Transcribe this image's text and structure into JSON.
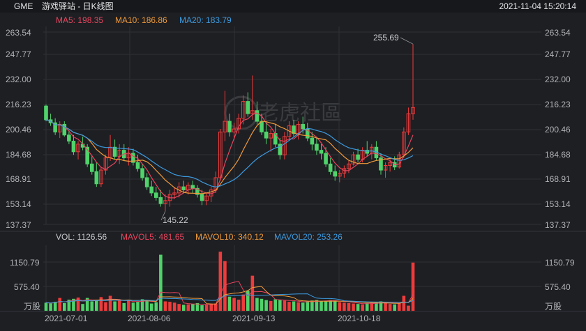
{
  "header": {
    "symbol": "GME",
    "name": "游戏驿站 - 日K线图",
    "datetime": "2021-11-04 15:20:14"
  },
  "ma_legend": [
    {
      "label": "MA5: 198.35",
      "color": "#e8455e"
    },
    {
      "label": "MA10: 186.86",
      "color": "#f09a3a"
    },
    {
      "label": "MA20: 183.79",
      "color": "#3c9be0"
    }
  ],
  "vol_legend": [
    {
      "label": "VOL: 1126.56",
      "color": "#c8c9cc"
    },
    {
      "label": "MAVOL5: 481.65",
      "color": "#e8455e"
    },
    {
      "label": "MAVOL10: 340.12",
      "color": "#f09a3a"
    },
    {
      "label": "MAVOL20: 253.26",
      "color": "#3c9be0"
    }
  ],
  "watermark": "老虎社區",
  "colors": {
    "up": "#ef3b3b",
    "down": "#4fd36a",
    "grid": "#2e3036",
    "axis_text": "#b0b2b6",
    "background": "#1e1f23"
  },
  "chart_data": [
    {
      "type": "candlestick",
      "title": "游戏驿站 - 日K线图",
      "y_ticks": [
        "263.54",
        "247.77",
        "232.00",
        "216.23",
        "200.46",
        "184.68",
        "168.91",
        "153.14",
        "137.37"
      ],
      "ylim": [
        137.37,
        263.54
      ],
      "annotations": {
        "high": "255.69",
        "low": "145.22"
      },
      "ohlc": [
        [
          215,
          216,
          205,
          206
        ],
        [
          206,
          210,
          202,
          204
        ],
        [
          204,
          207,
          196,
          198
        ],
        [
          198,
          205,
          194,
          203
        ],
        [
          203,
          205,
          195,
          196
        ],
        [
          196,
          199,
          190,
          192
        ],
        [
          192,
          196,
          183,
          185
        ],
        [
          185,
          192,
          180,
          190
        ],
        [
          190,
          195,
          186,
          188
        ],
        [
          188,
          190,
          175,
          177
        ],
        [
          177,
          182,
          170,
          172
        ],
        [
          172,
          178,
          162,
          164
        ],
        [
          164,
          175,
          162,
          173
        ],
        [
          173,
          183,
          170,
          181
        ],
        [
          181,
          196,
          179,
          188
        ],
        [
          188,
          193,
          180,
          182
        ],
        [
          182,
          190,
          177,
          186
        ],
        [
          186,
          190,
          179,
          181
        ],
        [
          181,
          188,
          176,
          184
        ],
        [
          184,
          187,
          176,
          178
        ],
        [
          178,
          183,
          172,
          174
        ],
        [
          174,
          177,
          166,
          168
        ],
        [
          168,
          171,
          160,
          162
        ],
        [
          162,
          166,
          156,
          158
        ],
        [
          158,
          162,
          153,
          155
        ],
        [
          155,
          160,
          149,
          151
        ],
        [
          151,
          157,
          146,
          153
        ],
        [
          153,
          160,
          149,
          157
        ],
        [
          157,
          162,
          154,
          158
        ],
        [
          158,
          165,
          155,
          162
        ],
        [
          162,
          166,
          158,
          160
        ],
        [
          160,
          165,
          157,
          163
        ],
        [
          163,
          166,
          158,
          161
        ],
        [
          161,
          163,
          155,
          157
        ],
        [
          157,
          160,
          150,
          153
        ],
        [
          153,
          158,
          150,
          156
        ],
        [
          156,
          162,
          152,
          160
        ],
        [
          160,
          172,
          158,
          168
        ],
        [
          168,
          200,
          166,
          198
        ],
        [
          198,
          225,
          192,
          205
        ],
        [
          205,
          210,
          195,
          198
        ],
        [
          198,
          204,
          193,
          200
        ],
        [
          200,
          210,
          197,
          207
        ],
        [
          207,
          222,
          203,
          218
        ],
        [
          218,
          224,
          208,
          210
        ],
        [
          210,
          235,
          206,
          212
        ],
        [
          212,
          218,
          203,
          205
        ],
        [
          205,
          210,
          196,
          198
        ],
        [
          198,
          205,
          190,
          194
        ],
        [
          194,
          200,
          185,
          197
        ],
        [
          197,
          203,
          188,
          190
        ],
        [
          190,
          194,
          180,
          183
        ],
        [
          183,
          198,
          180,
          195
        ],
        [
          195,
          205,
          192,
          202
        ],
        [
          202,
          206,
          195,
          197
        ],
        [
          197,
          205,
          193,
          203
        ],
        [
          203,
          208,
          197,
          200
        ],
        [
          200,
          204,
          192,
          194
        ],
        [
          194,
          198,
          186,
          190
        ],
        [
          190,
          194,
          183,
          186
        ],
        [
          186,
          190,
          180,
          184
        ],
        [
          184,
          188,
          175,
          177
        ],
        [
          177,
          181,
          170,
          172
        ],
        [
          172,
          176,
          166,
          169
        ],
        [
          169,
          173,
          165,
          171
        ],
        [
          171,
          176,
          168,
          174
        ],
        [
          174,
          179,
          171,
          177
        ],
        [
          177,
          185,
          176,
          183
        ],
        [
          183,
          187,
          178,
          180
        ],
        [
          180,
          188,
          178,
          186
        ],
        [
          186,
          192,
          182,
          184
        ],
        [
          184,
          190,
          180,
          188
        ],
        [
          188,
          192,
          179,
          181
        ],
        [
          181,
          184,
          170,
          173
        ],
        [
          173,
          178,
          168,
          176
        ],
        [
          176,
          180,
          172,
          178
        ],
        [
          178,
          182,
          173,
          175
        ],
        [
          175,
          185,
          174,
          183
        ],
        [
          183,
          201,
          181,
          198
        ],
        [
          198,
          214,
          196,
          210
        ],
        [
          210,
          255.69,
          206,
          214
        ]
      ],
      "ma_values": [
        {
          "name": "MA5",
          "last": 198.35
        },
        {
          "name": "MA10",
          "last": 186.86
        },
        {
          "name": "MA20",
          "last": 183.79
        }
      ]
    },
    {
      "type": "bar",
      "title": "VOL",
      "unit": "万股",
      "y_ticks": [
        "1150.79",
        "575.40",
        "万股"
      ],
      "x_ticks": [
        "2021-07-01",
        "2021-08-06",
        "2021-09-13",
        "2021-10-18"
      ],
      "values": [
        190,
        170,
        210,
        300,
        180,
        260,
        280,
        310,
        160,
        300,
        220,
        260,
        320,
        200,
        350,
        220,
        240,
        180,
        250,
        190,
        220,
        270,
        240,
        170,
        200,
        1310,
        220,
        210,
        190,
        160,
        140,
        150,
        160,
        180,
        130,
        140,
        150,
        170,
        1380,
        1160,
        330,
        300,
        260,
        380,
        470,
        820,
        300,
        280,
        250,
        230,
        270,
        250,
        240,
        210,
        220,
        200,
        190,
        220,
        240,
        250,
        230,
        220,
        250,
        240,
        200,
        190,
        180,
        170,
        160,
        150,
        180,
        190,
        200,
        220,
        180,
        160,
        150,
        170,
        350,
        120,
        1126.56
      ],
      "mavol": [
        {
          "name": "MAVOL5",
          "last": 481.65
        },
        {
          "name": "MAVOL10",
          "last": 340.12
        },
        {
          "name": "MAVOL20",
          "last": 253.26
        }
      ]
    }
  ]
}
